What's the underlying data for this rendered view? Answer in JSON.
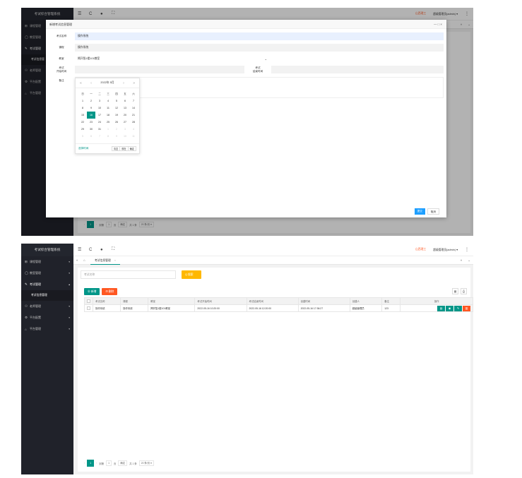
{
  "app": {
    "title": "考试综合管理系统",
    "header_link": "山西理工",
    "header_user": "超级管理员(admin) ▾",
    "tab_label": "考试信息管理",
    "tab_close": "×"
  },
  "sidebar": {
    "items": [
      {
        "icon": "⊞",
        "label": "课程管理",
        "arrow": "▾"
      },
      {
        "icon": "◯",
        "label": "教室管理",
        "arrow": "▾"
      },
      {
        "icon": "✎",
        "label": "考试管理",
        "arrow": "▴"
      },
      {
        "icon": "⚇",
        "label": "老师管理",
        "arrow": "▾"
      },
      {
        "icon": "⚙",
        "label": "平台配置",
        "arrow": "▾"
      },
      {
        "icon": "⌂",
        "label": "平台管理",
        "arrow": "▾"
      }
    ],
    "sub_item": "考试信息管理",
    "sub_item_top": "考试信息管"
  },
  "search": {
    "placeholder": "考试名称",
    "button": "Q 搜索"
  },
  "toolbar": {
    "add": "⊕ 新增",
    "delete": "⊟ 删除"
  },
  "table": {
    "headers": [
      "考试名称",
      "课程",
      "教室",
      "考试开始时间",
      "考试结束时间",
      "创建时间",
      "创建人",
      "备注",
      "操作"
    ],
    "rows": [
      [
        "操作系统",
        "操作系统",
        "揭开智1楼101教室",
        "2022-05-16 10:20:00",
        "2022-05-16 12:20:00",
        "2022-05-16 17:36:27",
        "超级管理员",
        "123"
      ]
    ]
  },
  "pager": {
    "current": "1",
    "goto_label": "到第",
    "goto_value": "1",
    "page_unit": "页",
    "confirm": "确定",
    "total": "共 1 条",
    "page_size": "20 条/页 ▾"
  },
  "modal": {
    "title": "新增考试信息管理",
    "controls": "— □ ×",
    "name_label": "考试名称",
    "name_value": "操作系统",
    "course_label": "课程",
    "course_value": "操作系统",
    "room_label": "教室",
    "room_value": "揭开智1楼101教室",
    "start_label_1": "考试",
    "start_label_2": "开始时间",
    "end_label_1": "考试",
    "end_label_2": "结束时间",
    "note_label": "备注",
    "submit": "提交",
    "cancel": "取消"
  },
  "datepicker": {
    "title": "2022年 5月",
    "weekdays": [
      "日",
      "一",
      "二",
      "三",
      "四",
      "五",
      "六"
    ],
    "days": [
      [
        "1",
        "2",
        "3",
        "4",
        "5",
        "6",
        "7"
      ],
      [
        "8",
        "9",
        "10",
        "11",
        "12",
        "13",
        "14"
      ],
      [
        "15",
        "16",
        "17",
        "18",
        "19",
        "20",
        "21"
      ],
      [
        "22",
        "23",
        "24",
        "25",
        "26",
        "27",
        "28"
      ],
      [
        "29",
        "30",
        "31",
        "1",
        "2",
        "3",
        "4"
      ],
      [
        "5",
        "6",
        "7",
        "8",
        "9",
        "10",
        "11"
      ]
    ],
    "selected_day": "16",
    "select_time": "选择时间",
    "clear": "清空",
    "now": "现在",
    "confirm": "确定"
  },
  "colors": {
    "primary": "#009688",
    "warn": "#ff5722",
    "search": "#ffb800",
    "submit": "#1e9fff",
    "sidebar": "#20222a"
  }
}
